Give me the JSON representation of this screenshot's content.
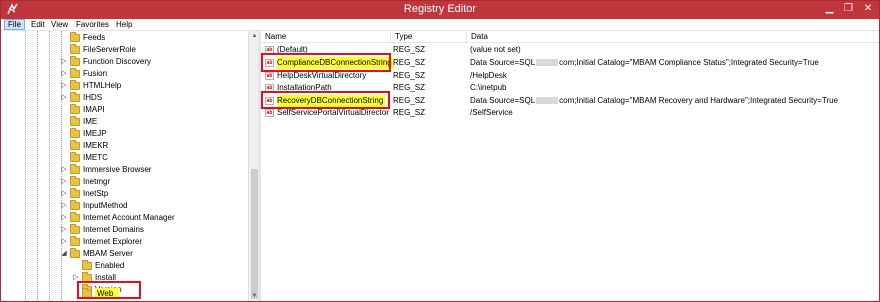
{
  "window": {
    "title": "Registry Editor"
  },
  "menu": [
    "File",
    "Edit",
    "View",
    "Favorites",
    "Help"
  ],
  "tree": {
    "items": [
      {
        "label": "Feeds",
        "arrow": ""
      },
      {
        "label": "FileServerRole",
        "arrow": ""
      },
      {
        "label": "Function Discovery",
        "arrow": "▷"
      },
      {
        "label": "Fusion",
        "arrow": "▷"
      },
      {
        "label": "HTMLHelp",
        "arrow": "▷"
      },
      {
        "label": "IHDS",
        "arrow": "▷"
      },
      {
        "label": "IMAPI",
        "arrow": ""
      },
      {
        "label": "IME",
        "arrow": ""
      },
      {
        "label": "IMEJP",
        "arrow": ""
      },
      {
        "label": "IMEKR",
        "arrow": ""
      },
      {
        "label": "IMETC",
        "arrow": ""
      },
      {
        "label": "Immersive Browser",
        "arrow": "▷"
      },
      {
        "label": "Inetmgr",
        "arrow": "▷"
      },
      {
        "label": "InetStp",
        "arrow": "▷"
      },
      {
        "label": "InputMethod",
        "arrow": "▷"
      },
      {
        "label": "Internet Account Manager",
        "arrow": "▷"
      },
      {
        "label": "Internet Domains",
        "arrow": "▷"
      },
      {
        "label": "Internet Explorer",
        "arrow": "▷"
      },
      {
        "label": "MBAM Server",
        "arrow": "◢"
      },
      {
        "label": "Enabled",
        "arrow": ""
      },
      {
        "label": "Install",
        "arrow": "▷"
      },
      {
        "label": "Version",
        "arrow": ""
      },
      {
        "label": "Web",
        "arrow": ""
      }
    ]
  },
  "list": {
    "columns": [
      "Name",
      "Type",
      "Data"
    ],
    "rows": [
      {
        "name": "(Default)",
        "type": "REG_SZ",
        "data": "(value not set)",
        "data_a": "",
        "data_b": ""
      },
      {
        "name": "ComplianceDBConnectionString",
        "type": "REG_SZ",
        "data": "",
        "data_a": "Data Source=SQL",
        "data_b": "com;Initial Catalog=\"MBAM Compliance Status\";Integrated Security=True"
      },
      {
        "name": "HelpDeskVirtualDirectory",
        "type": "REG_SZ",
        "data": "/HelpDesk",
        "data_a": "",
        "data_b": ""
      },
      {
        "name": "InstallationPath",
        "type": "REG_SZ",
        "data": "C:\\inetpub",
        "data_a": "",
        "data_b": ""
      },
      {
        "name": "RecoveryDBConnectionString",
        "type": "REG_SZ",
        "data": "",
        "data_a": "Data Source=SQL",
        "data_b": "com;Initial Catalog=\"MBAM Recovery and Hardware\";Integrated Security=True"
      },
      {
        "name": "SelfServicePortalVirtualDirectory",
        "type": "REG_SZ",
        "data": "/SelfService",
        "data_a": "",
        "data_b": ""
      }
    ]
  },
  "colors": {
    "frame": "#c1363d",
    "highlight": "#ffff33",
    "annotation": "#e0101d"
  },
  "icons": {
    "app": "registry-editor-icon",
    "value": "string-value-icon",
    "key": "folder-icon"
  }
}
